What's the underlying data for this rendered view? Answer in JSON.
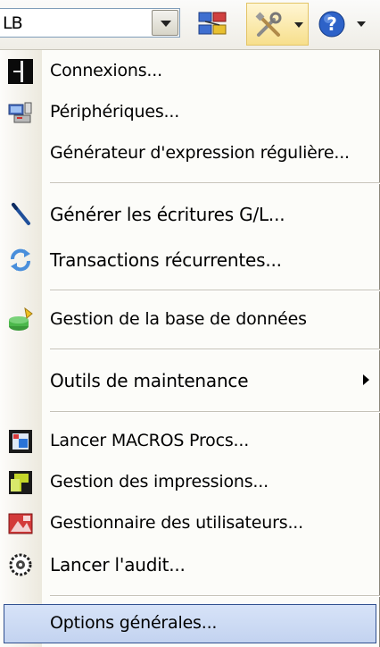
{
  "toolbar": {
    "combo_value": "LB",
    "icons": [
      "network-connections-icon",
      "tools-icon",
      "help-icon"
    ]
  },
  "menu": {
    "items": [
      {
        "label": "Connexions...",
        "icon": "connections-icon"
      },
      {
        "label": "Périphériques...",
        "icon": "devices-icon"
      },
      {
        "label": "Générateur d'expression régulière...",
        "icon": ""
      },
      {
        "label": "Générer les écritures G/L...",
        "icon": "pencil-icon"
      },
      {
        "label": "Transactions récurrentes...",
        "icon": "recurring-icon"
      },
      {
        "label": "Gestion de la base de données",
        "icon": "database-icon"
      },
      {
        "label": "Outils de maintenance",
        "icon": "",
        "submenu": true
      },
      {
        "label": "Lancer MACROS Procs...",
        "icon": "macro-icon"
      },
      {
        "label": "Gestion des impressions...",
        "icon": "print-management-icon"
      },
      {
        "label": "Gestionnaire des utilisateurs...",
        "icon": "users-icon"
      },
      {
        "label": "Lancer l'audit...",
        "icon": "audit-icon"
      },
      {
        "label": "Options générales...",
        "icon": "",
        "selected": true
      }
    ]
  },
  "colors": {
    "highlight": "#c3d3f0",
    "highlight_border": "#2f4f8f",
    "separator": "#c5c2b8"
  }
}
